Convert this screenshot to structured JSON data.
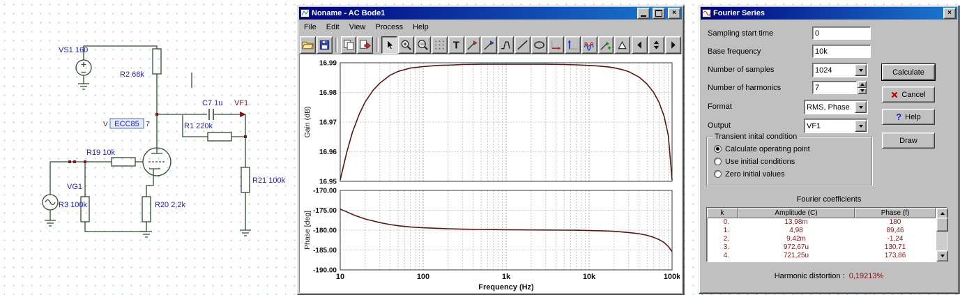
{
  "schematic": {
    "labels": {
      "vs1": "VS1 160",
      "r2": "R2 68k",
      "c7": "C7 1u",
      "vf1": "VF1",
      "r1": "R1 220k",
      "tube_prefix": "V",
      "tube": "ECC85",
      "tube_suffix": "7",
      "r19": "R19 10k",
      "vg1": "VG1",
      "r3": "R3 100k",
      "r20": "R20 2,2k",
      "r21": "R21 100k"
    }
  },
  "bode_window": {
    "title": "Noname - AC Bode1",
    "menu": [
      "File",
      "Edit",
      "View",
      "Process",
      "Help"
    ],
    "toolbar": [
      {
        "icon": "open",
        "name": "open"
      },
      {
        "icon": "save",
        "name": "save"
      },
      {
        "type": "sep"
      },
      {
        "icon": "copy",
        "name": "copy"
      },
      {
        "icon": "export",
        "name": "export"
      },
      {
        "type": "sep"
      },
      {
        "icon": "cursor",
        "name": "select-cursor",
        "pressed": true
      },
      {
        "icon": "zoomin",
        "name": "zoom-in"
      },
      {
        "icon": "zoom100",
        "name": "zoom-100"
      },
      {
        "icon": "grid",
        "name": "grid-toggle"
      },
      {
        "icon": "text",
        "name": "text-tool"
      },
      {
        "icon": "probea",
        "name": "cursor-a"
      },
      {
        "icon": "probeb",
        "name": "cursor-b"
      },
      {
        "icon": "shape",
        "name": "shape-tool"
      },
      {
        "icon": "line",
        "name": "line-tool"
      },
      {
        "icon": "ellipse",
        "name": "ellipse-tool"
      },
      {
        "icon": "axisx",
        "name": "x-axis-settings"
      },
      {
        "icon": "axisy",
        "name": "y-axis-settings"
      },
      {
        "icon": "waveform",
        "name": "curve-style"
      },
      {
        "icon": "probec",
        "name": "add-curve"
      },
      {
        "icon": "marker",
        "name": "marker-tool"
      },
      {
        "type": "spacer"
      },
      {
        "icon": "prev",
        "name": "prev-page"
      },
      {
        "icon": "spin",
        "name": "page-spinner"
      },
      {
        "icon": "next",
        "name": "next-page"
      }
    ]
  },
  "chart_data": [
    {
      "type": "line",
      "title": "AC Bode - Gain",
      "ylabel": "Gain (dB)",
      "xlabel": "Frequency (Hz)",
      "x_scale": "log",
      "xlim": [
        10,
        100000
      ],
      "ylim": [
        16.95,
        16.99
      ],
      "yticks": [
        16.99,
        16.98,
        16.97,
        16.96,
        16.95
      ],
      "ytick_labels": [
        "16.99",
        "16.98",
        "16.97",
        "16.96",
        "16.95"
      ],
      "xticks": [
        10,
        100,
        1000,
        10000,
        100000
      ],
      "xtick_labels": [
        "10",
        "100",
        "1k",
        "10k",
        "100k"
      ],
      "grid": true,
      "series": [
        {
          "name": "Gain",
          "color": "#5c1414",
          "x": [
            10,
            12,
            14,
            17,
            20,
            25,
            30,
            40,
            50,
            70,
            100,
            150,
            200,
            300,
            500,
            700,
            1000,
            2000,
            3000,
            5000,
            7000,
            10000,
            13000,
            17000,
            20000,
            25000,
            30000,
            40000,
            50000,
            60000,
            70000,
            80000,
            90000,
            100000
          ],
          "y": [
            16.9505,
            16.9598,
            16.9665,
            16.9727,
            16.9768,
            16.9808,
            16.9831,
            16.9858,
            16.9871,
            16.9882,
            16.9887,
            16.9891,
            16.9892,
            16.9894,
            16.9895,
            16.9895,
            16.9895,
            16.9895,
            16.9895,
            16.9894,
            16.9893,
            16.9891,
            16.9889,
            16.9886,
            16.9883,
            16.9877,
            16.987,
            16.9852,
            16.9828,
            16.98,
            16.9765,
            16.972,
            16.9655,
            16.9505
          ]
        }
      ]
    },
    {
      "type": "line",
      "title": "AC Bode - Phase",
      "ylabel": "Phase [deg]",
      "xlabel": "Frequency (Hz)",
      "x_scale": "log",
      "xlim": [
        10,
        100000
      ],
      "ylim": [
        -190,
        -170
      ],
      "yticks": [
        -170,
        -175,
        -180,
        -185,
        -190
      ],
      "ytick_labels": [
        "-170.00",
        "-175.00",
        "-180.00",
        "-185.00",
        "-190.00"
      ],
      "xticks": [
        10,
        100,
        1000,
        10000,
        100000
      ],
      "xtick_labels": [
        "10",
        "100",
        "1k",
        "10k",
        "100k"
      ],
      "grid": true,
      "series": [
        {
          "name": "Phase",
          "color": "#5c1414",
          "x": [
            10,
            12,
            15,
            20,
            25,
            30,
            40,
            50,
            70,
            100,
            150,
            200,
            300,
            500,
            700,
            1000,
            2000,
            3000,
            5000,
            7000,
            10000,
            15000,
            20000,
            30000,
            40000,
            50000,
            60000,
            70000,
            80000,
            90000,
            100000
          ],
          "y": [
            -174.7,
            -175.4,
            -176.3,
            -177.2,
            -177.7,
            -178.1,
            -178.6,
            -178.9,
            -179.2,
            -179.4,
            -179.55,
            -179.65,
            -179.75,
            -179.82,
            -179.86,
            -179.9,
            -179.95,
            -179.97,
            -180.0,
            -180.02,
            -180.1,
            -180.2,
            -180.3,
            -180.6,
            -180.9,
            -181.3,
            -181.8,
            -182.4,
            -183.1,
            -184.1,
            -185.4
          ]
        }
      ]
    }
  ],
  "fourier": {
    "title": "Fourier Series",
    "sampling_label": "Sampling start time",
    "sampling_value": "0",
    "base_label": "Base frequency",
    "base_value": "10k",
    "samples_label": "Number of samples",
    "samples_value": "1024",
    "harmonics_label": "Number of harmonics",
    "harmonics_value": "7",
    "format_label": "Format",
    "format_value": "RMS, Phase",
    "output_label": "Output",
    "output_value": "VF1",
    "group_title": "Transient inital condition",
    "radio1": "Calculate operating point",
    "radio2": "Use initial conditions",
    "radio3": "Zero initial values",
    "btn_calculate": "Calculate",
    "btn_cancel": "Cancel",
    "btn_help": "Help",
    "btn_draw": "Draw",
    "coeff_title": "Fourier coefficients",
    "coeff_headers": [
      "k",
      "Amplitude (C)",
      "Phase (f)"
    ],
    "coeff_rows": [
      [
        "0.",
        "13,98m",
        "180"
      ],
      [
        "1.",
        "4,98",
        "89,46"
      ],
      [
        "2.",
        "9,42m",
        "-1,24"
      ],
      [
        "3.",
        "972,67u",
        "130,71"
      ],
      [
        "4.",
        "721,25u",
        "173,86"
      ]
    ],
    "distortion_label": "Harmonic distortion :",
    "distortion_value": "0,19213%"
  }
}
